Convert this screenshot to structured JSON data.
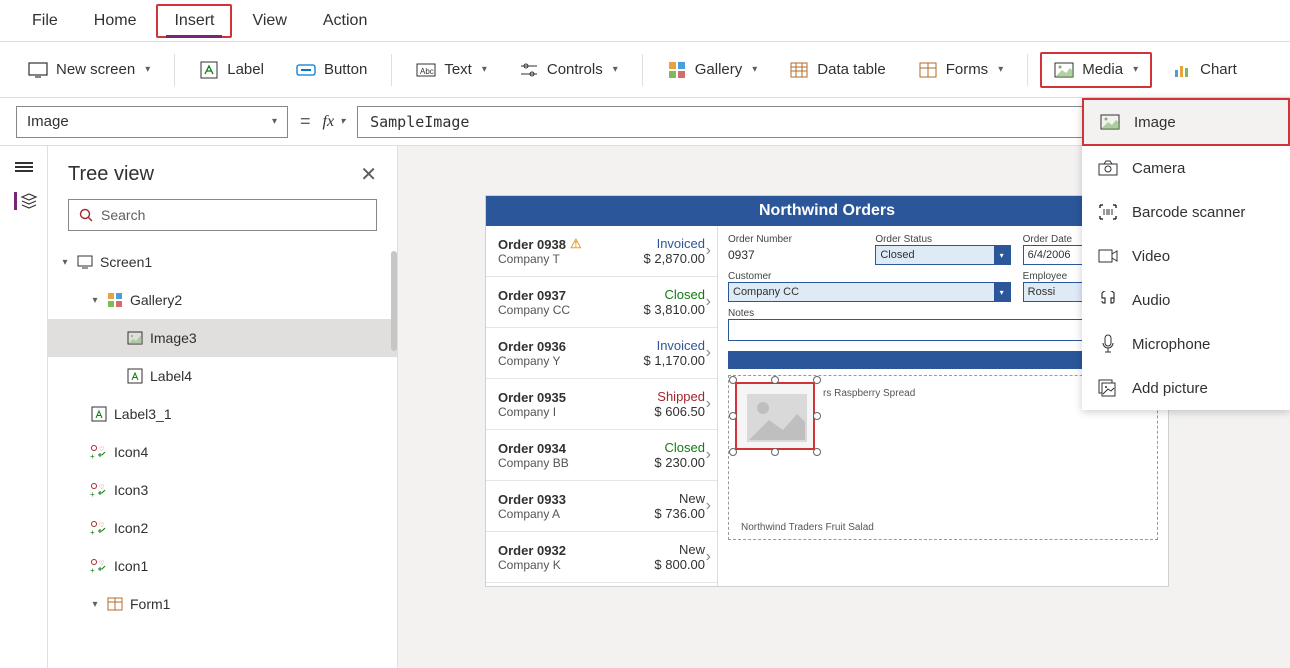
{
  "menu": {
    "tabs": [
      "File",
      "Home",
      "Insert",
      "View",
      "Action"
    ],
    "active": "Insert"
  },
  "ribbon": {
    "new_screen": "New screen",
    "label": "Label",
    "button": "Button",
    "text": "Text",
    "controls": "Controls",
    "gallery": "Gallery",
    "data_table": "Data table",
    "forms": "Forms",
    "media": "Media",
    "chart": "Chart"
  },
  "formula": {
    "property": "Image",
    "value": "SampleImage"
  },
  "media_menu": {
    "image": "Image",
    "camera": "Camera",
    "barcode": "Barcode scanner",
    "video": "Video",
    "audio": "Audio",
    "microphone": "Microphone",
    "add_picture": "Add picture"
  },
  "tree": {
    "title": "Tree view",
    "search_placeholder": "Search",
    "nodes": {
      "screen1": "Screen1",
      "gallery2": "Gallery2",
      "image3": "Image3",
      "label4": "Label4",
      "label3_1": "Label3_1",
      "icon4": "Icon4",
      "icon3": "Icon3",
      "icon2": "Icon2",
      "icon1": "Icon1",
      "form1": "Form1"
    }
  },
  "app": {
    "title": "Northwind Orders",
    "orders": [
      {
        "num": "Order 0938",
        "co": "Company T",
        "status": "Invoiced",
        "amt": "$ 2,870.00",
        "warn": true
      },
      {
        "num": "Order 0937",
        "co": "Company CC",
        "status": "Closed",
        "amt": "$ 3,810.00"
      },
      {
        "num": "Order 0936",
        "co": "Company Y",
        "status": "Invoiced",
        "amt": "$ 1,170.00"
      },
      {
        "num": "Order 0935",
        "co": "Company I",
        "status": "Shipped",
        "amt": "$ 606.50"
      },
      {
        "num": "Order 0934",
        "co": "Company BB",
        "status": "Closed",
        "amt": "$ 230.00"
      },
      {
        "num": "Order 0933",
        "co": "Company A",
        "status": "New",
        "amt": "$ 736.00"
      },
      {
        "num": "Order 0932",
        "co": "Company K",
        "status": "New",
        "amt": "$ 800.00"
      }
    ],
    "detail": {
      "labels": {
        "order_number": "Order Number",
        "order_status": "Order Status",
        "order_date": "Order Date",
        "customer": "Customer",
        "employee": "Employee",
        "notes": "Notes"
      },
      "order_number": "0937",
      "order_status": "Closed",
      "order_date": "6/4/2006",
      "customer": "Company CC",
      "employee": "Rossi",
      "item1": "rs Raspberry Spread",
      "item2": "Northwind Traders Fruit Salad"
    }
  }
}
